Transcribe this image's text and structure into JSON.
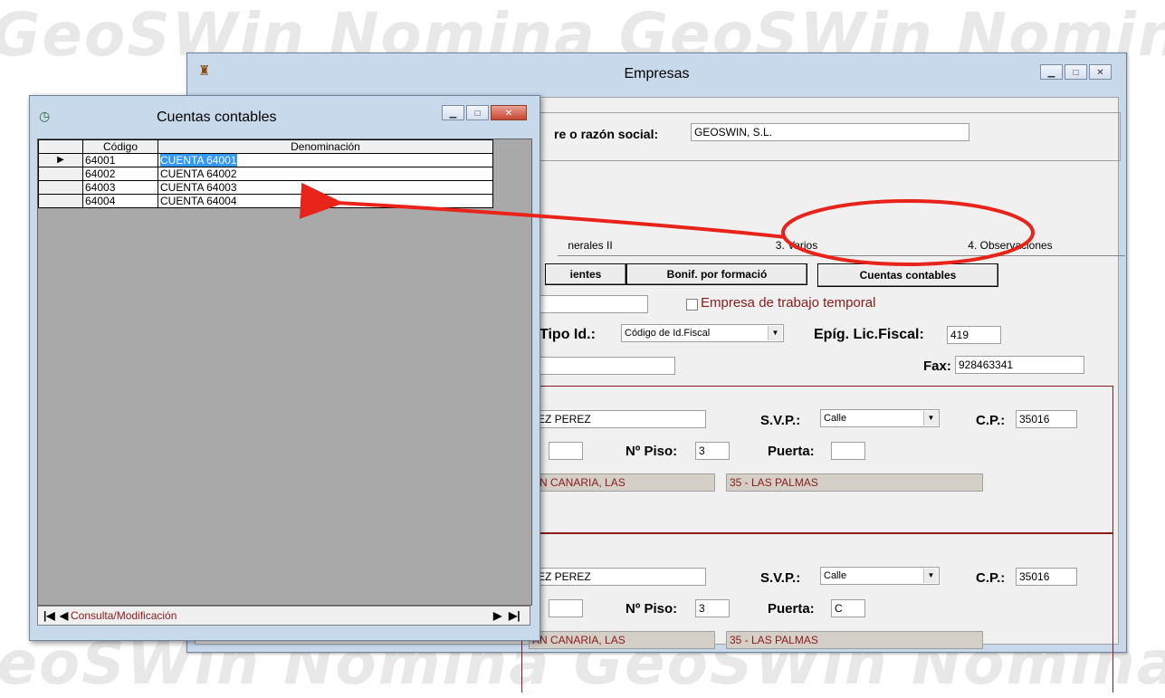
{
  "watermark": {
    "text": "GeoSWin Nomina"
  },
  "empresas": {
    "title": "Empresas",
    "name_label": "re o razón social:",
    "name_value": "GEOSWIN, S.L.",
    "tabs": [
      "nerales II",
      "3. Varios",
      "4. Observaciones"
    ],
    "buttons": [
      "ientes",
      "Bonif. por formació",
      "Cuentas contables"
    ],
    "temp_label": "Empresa de trabajo temporal",
    "tipo_id_label": "Tipo Id.:",
    "tipo_id_value": "Código de Id.Fiscal",
    "epig_label": "Epíg. Lic.Fiscal:",
    "epig_value": "419",
    "fax_label": "Fax:",
    "fax_value": "928463341",
    "addresses": [
      {
        "street": "JEZ PEREZ",
        "svp_label": "S.V.P.:",
        "svp_value": "Calle",
        "cp_label": "C.P.:",
        "cp_value": "35016",
        "piso_label": "Nº Piso:",
        "piso_value": "3",
        "puerta_label": "Puerta:",
        "puerta_value": "",
        "city": "AN CANARIA, LAS",
        "province": "35 - LAS PALMAS"
      },
      {
        "street": "JEZ PEREZ",
        "svp_label": "S.V.P.:",
        "svp_value": "Calle",
        "cp_label": "C.P.:",
        "cp_value": "35016",
        "piso_label": "Nº Piso:",
        "piso_value": "3",
        "puerta_label": "Puerta:",
        "puerta_value": "C",
        "city": "AN CANARIA, LAS",
        "province": "35 - LAS PALMAS"
      }
    ]
  },
  "cuentas": {
    "title": "Cuentas contables",
    "columns": [
      "Código",
      "Denominación"
    ],
    "rows": [
      {
        "codigo": "64001",
        "denominacion": "CUENTA 64001"
      },
      {
        "codigo": "64002",
        "denominacion": "CUENTA 64002"
      },
      {
        "codigo": "64003",
        "denominacion": "CUENTA 64003"
      },
      {
        "codigo": "64004",
        "denominacion": "CUENTA 64004"
      }
    ],
    "status": "Consulta/Modificación"
  },
  "colors": {
    "annotation": "#e8231a",
    "frame": "#8b1a1a",
    "titlebar": "#c9d9ec"
  }
}
